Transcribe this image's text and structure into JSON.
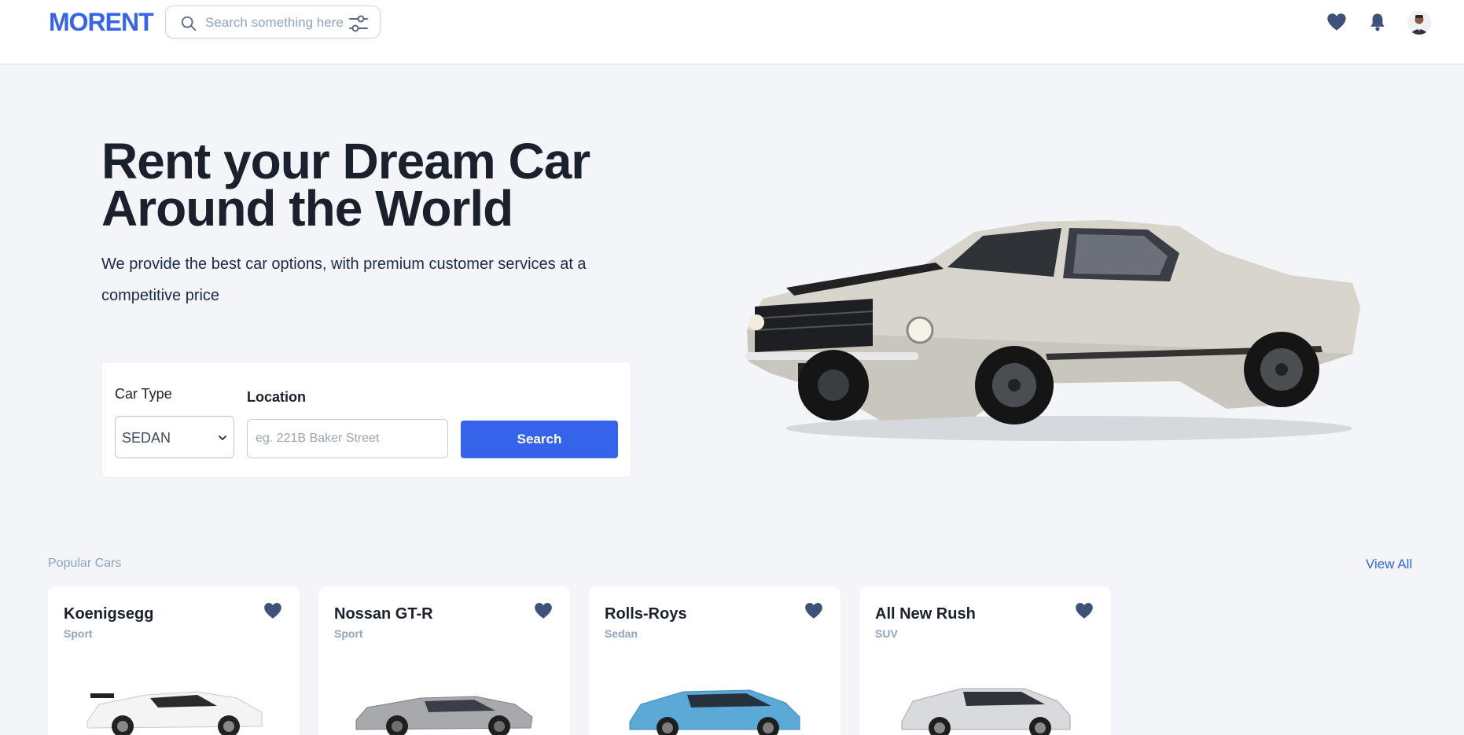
{
  "header": {
    "logo": "MORENT",
    "search_placeholder": "Search something here",
    "icons": [
      "heart-icon",
      "bell-icon",
      "avatar"
    ]
  },
  "hero": {
    "title_line1": "Rent your Dream Car",
    "title_line2": "Around the World",
    "subtitle": "We provide the best car options, with premium customer services at a competitive price"
  },
  "booking": {
    "car_type_label": "Car Type",
    "car_type_value": "SEDAN",
    "location_label": "Location",
    "location_placeholder": "eg. 221B Baker Street",
    "search_label": "Search"
  },
  "popular": {
    "title": "Popular Cars",
    "view_all": "View All",
    "cars": [
      {
        "name": "Koenigsegg",
        "type": "Sport",
        "color": "#f2f2f2"
      },
      {
        "name": "Nossan GT-R",
        "type": "Sport",
        "color": "#a7a9ad"
      },
      {
        "name": "Rolls-Roys",
        "type": "Sedan",
        "color": "#5aa9d6"
      },
      {
        "name": "All New Rush",
        "type": "SUV",
        "color": "#d9dadd"
      }
    ]
  },
  "colors": {
    "accent": "#3563e9",
    "heart": "#3d5278",
    "muted": "#90a3bf",
    "background": "#f3f5f8"
  }
}
